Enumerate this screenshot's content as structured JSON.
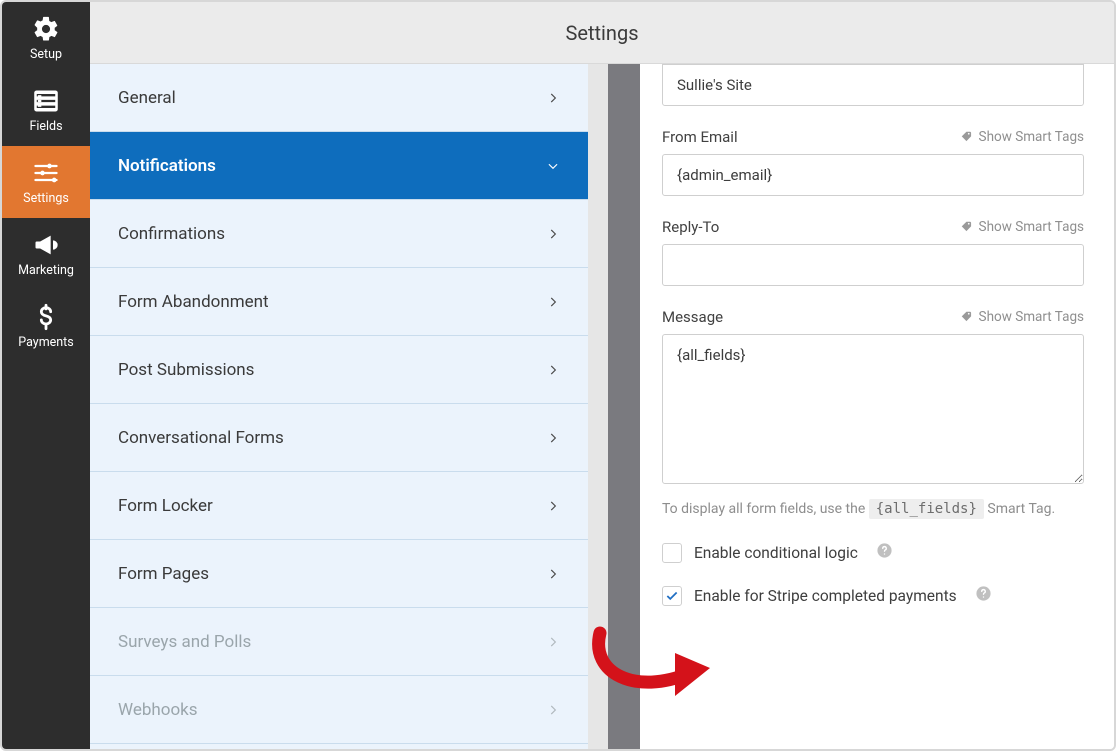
{
  "header": {
    "title": "Settings"
  },
  "iconbar": {
    "items": [
      {
        "label": "Setup"
      },
      {
        "label": "Fields"
      },
      {
        "label": "Settings"
      },
      {
        "label": "Marketing"
      },
      {
        "label": "Payments"
      }
    ]
  },
  "settings_menu": {
    "items": [
      {
        "label": "General"
      },
      {
        "label": "Notifications"
      },
      {
        "label": "Confirmations"
      },
      {
        "label": "Form Abandonment"
      },
      {
        "label": "Post Submissions"
      },
      {
        "label": "Conversational Forms"
      },
      {
        "label": "Form Locker"
      },
      {
        "label": "Form Pages"
      },
      {
        "label": "Surveys and Polls"
      },
      {
        "label": "Webhooks"
      }
    ]
  },
  "form": {
    "from_name_value": "Sullie's Site",
    "from_email_label": "From Email",
    "from_email_value": "{admin_email}",
    "reply_to_label": "Reply-To",
    "reply_to_value": "",
    "message_label": "Message",
    "message_value": "{all_fields}",
    "smart_tags_label": "Show Smart Tags",
    "hint_prefix": "To display all form fields, use the ",
    "hint_code": "{all_fields}",
    "hint_suffix": " Smart Tag.",
    "cb_conditional": "Enable conditional logic",
    "cb_stripe": "Enable for Stripe completed payments"
  }
}
